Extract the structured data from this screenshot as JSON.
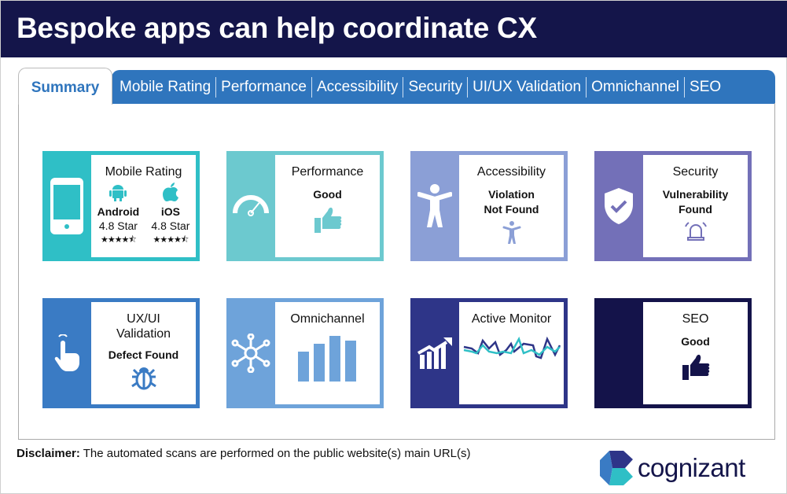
{
  "header": {
    "title": "Bespoke apps can help coordinate CX"
  },
  "tabs": [
    {
      "label": "Summary",
      "active": true
    },
    {
      "label": "Mobile Rating"
    },
    {
      "label": "Performance"
    },
    {
      "label": "Accessibility"
    },
    {
      "label": "Security"
    },
    {
      "label": "UI/UX Validation"
    },
    {
      "label": "Omnichannel"
    },
    {
      "label": "SEO"
    }
  ],
  "colors": {
    "header": "#14154a",
    "tab_bar": "#2f75bd",
    "cards": [
      "#2fbfc6",
      "#6cc9cf",
      "#8b9fd6",
      "#7370b8",
      "#3a7bc4",
      "#6ea3da",
      "#2e3588",
      "#14134a"
    ]
  },
  "cards": {
    "mobile": {
      "title": "Mobile Rating",
      "icon": "phone-icon",
      "android": {
        "label": "Android",
        "rating": "4.8 Star",
        "stars": "★★★★⯪"
      },
      "ios": {
        "label": "iOS",
        "rating": "4.8 Star",
        "stars": "★★★★⯪"
      }
    },
    "performance": {
      "title": "Performance",
      "value": "Good",
      "icon": "speedometer-icon"
    },
    "accessibility": {
      "title": "Accessibility",
      "value_line1": "Violation",
      "value_line2": "Not Found",
      "icon": "accessibility-icon"
    },
    "security": {
      "title": "Security",
      "value_line1": "Vulnerability",
      "value_line2": "Found",
      "icon": "shield-check-icon"
    },
    "uxui": {
      "title_line1": "UX/UI",
      "title_line2": "Validation",
      "value": "Defect Found",
      "icon": "touch-icon"
    },
    "omnichannel": {
      "title": "Omnichannel",
      "icon": "network-icon"
    },
    "monitor": {
      "title": "Active Monitor",
      "icon": "growth-chart-icon"
    },
    "seo": {
      "title": "SEO",
      "value": "Good",
      "icon": "thumbs-up-icon"
    }
  },
  "footer": {
    "disclaimer_label": "Disclaimer:",
    "disclaimer_text": " The automated scans are performed on the public website(s) main URL(s)",
    "logo_text": "cognizant"
  }
}
